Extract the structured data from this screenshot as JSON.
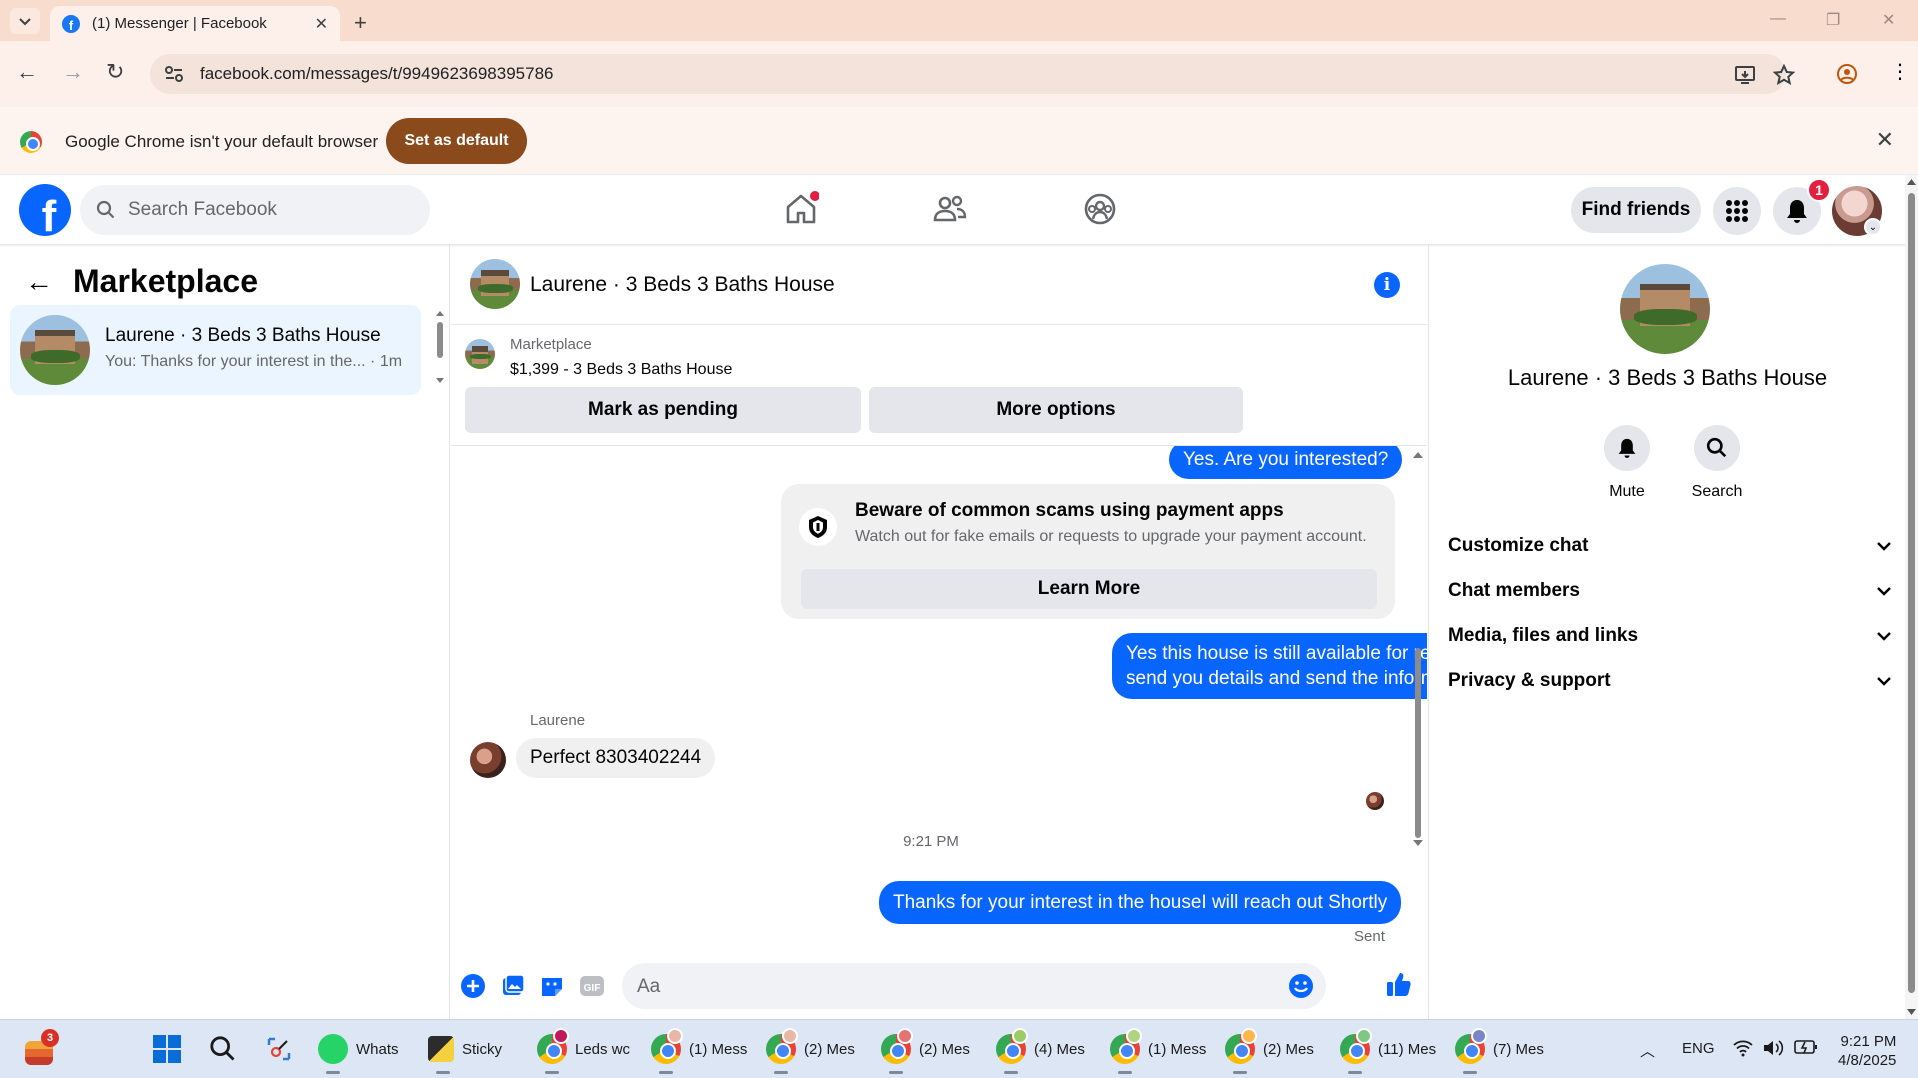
{
  "browser": {
    "tab_title": "(1) Messenger | Facebook",
    "url": "facebook.com/messages/t/9949623698395786",
    "infobar_message": "Google Chrome isn't your default browser",
    "infobar_button": "Set as default",
    "colors": {
      "tabstrip": "#f8dccd",
      "infobar_button": "#8a4a1c"
    }
  },
  "fb_nav": {
    "search_placeholder": "Search Facebook",
    "find_friends": "Find friends",
    "notification_count": "1",
    "icons": [
      "home-icon",
      "friends-icon",
      "groups-icon",
      "menu-grid-icon",
      "bell-icon"
    ],
    "brand_color": "#0866ff"
  },
  "left_panel": {
    "title": "Marketplace",
    "conversations": [
      {
        "name": "Laurene · 3 Beds 3 Baths House",
        "snippet": "You: Thanks for your interest in the...",
        "time": "1m"
      }
    ]
  },
  "chat": {
    "header_name": "Laurene · 3 Beds 3 Baths House",
    "marketplace_label": "Marketplace",
    "listing": "$1,399 - 3 Beds 3 Baths House",
    "mark_pending": "Mark as pending",
    "more_options": "More options",
    "messages": {
      "out_1": "Yes. Are you interested?",
      "scam_title": "Beware of common scams using payment apps",
      "scam_subtitle": "Watch out for fake emails or requests to upgrade your payment account.",
      "learn_more": "Learn More",
      "out_2": "Yes this house is still available for rent, let me have your contact number so i can send you details and send the information about house.",
      "sender_name": "Laurene",
      "in_1": "Perfect 8303402244",
      "timestamp": "9:21 PM",
      "out_3": "Thanks for your interest in the houseI will reach out Shortly",
      "status": "Sent"
    },
    "composer_placeholder": "Aa"
  },
  "right_panel": {
    "name": "Laurene · 3 Beds 3 Baths House",
    "actions": {
      "mute": "Mute",
      "search": "Search"
    },
    "sections": [
      "Customize chat",
      "Chat members",
      "Media, files and links",
      "Privacy & support"
    ]
  },
  "taskbar": {
    "weather_badge": "3",
    "apps": [
      {
        "label": "Whats"
      },
      {
        "label": "Sticky"
      },
      {
        "label": "Leds wc"
      },
      {
        "label": "(1) Mess"
      },
      {
        "label": "(2) Mes"
      },
      {
        "label": "(2) Mes"
      },
      {
        "label": "(4) Mes"
      },
      {
        "label": "(1) Mess"
      },
      {
        "label": "(2) Mes"
      },
      {
        "label": "(11) Mes"
      },
      {
        "label": "(7) Mes"
      }
    ],
    "language": "ENG",
    "time": "9:21 PM",
    "date": "4/8/2025"
  }
}
